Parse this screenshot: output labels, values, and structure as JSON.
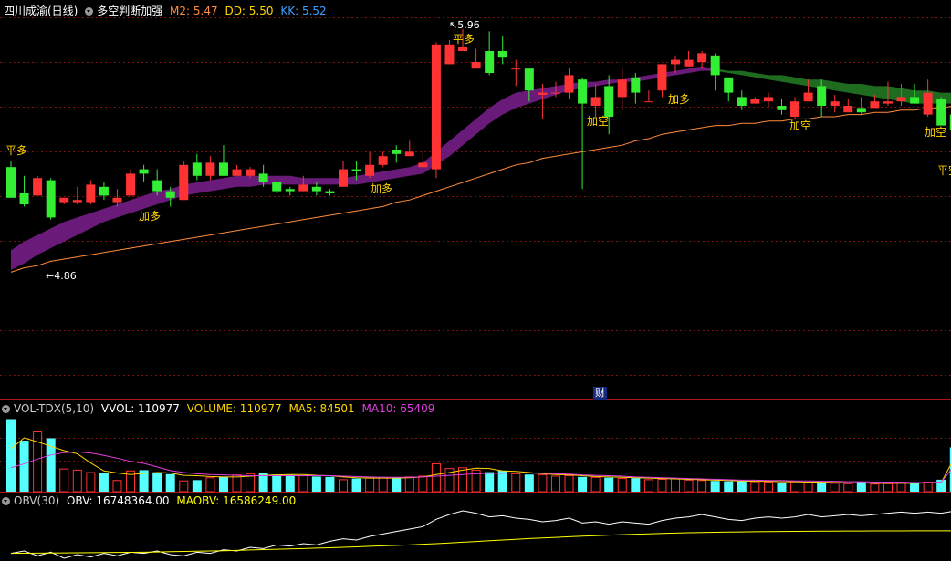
{
  "main_header": {
    "stock": "四川成渝(日线)",
    "indicator": "多空判断加强",
    "m2": "M2: 5.47",
    "dd": "DD: 5.50",
    "kk": "KK: 5.52"
  },
  "vol_header": {
    "name": "VOL-TDX(5,10)",
    "vvol": "VVOL: 110977",
    "volume": "VOLUME: 110977",
    "ma5": "MA5: 84501",
    "ma10": "MA10: 65409"
  },
  "obv_header": {
    "name": "OBV(30)",
    "obv": "OBV: 16748364.00",
    "maobv": "MAOBV: 16586249.00"
  },
  "annotations": {
    "high_price": "5.96",
    "low_price": "4.86",
    "cai": "财"
  },
  "signals": [
    {
      "label": "平多",
      "key": "s0"
    },
    {
      "label": "加多",
      "key": "s1"
    },
    {
      "label": "加多",
      "key": "s2"
    },
    {
      "label": "平多",
      "key": "s3"
    },
    {
      "label": "加空",
      "key": "s4"
    },
    {
      "label": "加多",
      "key": "s5"
    },
    {
      "label": "加空",
      "key": "s6"
    },
    {
      "label": "加空",
      "key": "s7"
    },
    {
      "label": "平空",
      "key": "s8"
    }
  ],
  "colors": {
    "background": "#000000",
    "up_candle": "#ff3333",
    "down_candle": "#33ee33",
    "vol_down": "#55ffff",
    "ribbon_long": "#6a1b7a",
    "ribbon_short": "#1f6b1f",
    "ma_line": "#ff8c3a",
    "grid": "#7a1010",
    "signal_text": "#ffd400",
    "m2": "#ff8c3a",
    "dd": "#ffd400",
    "kk": "#3aa0ff",
    "ma10": "#e040e0",
    "obv_line": "#ffffff",
    "maobv_line": "#ffff00"
  },
  "chart_data": {
    "type": "candlestick",
    "y_range": [
      4.86,
      5.96
    ],
    "candles": [
      [
        5.33,
        5.19,
        5.36,
        5.19
      ],
      [
        5.21,
        5.16,
        5.29,
        5.15
      ],
      [
        5.2,
        5.28,
        5.29,
        5.2
      ],
      [
        5.27,
        5.1,
        5.28,
        5.09
      ],
      [
        5.17,
        5.19,
        5.19,
        5.16
      ],
      [
        5.17,
        5.18,
        5.24,
        5.16
      ],
      [
        5.17,
        5.25,
        5.27,
        5.16
      ],
      [
        5.24,
        5.2,
        5.26,
        5.18
      ],
      [
        5.17,
        5.19,
        5.23,
        5.15
      ],
      [
        5.2,
        5.3,
        5.32,
        5.2
      ],
      [
        5.32,
        5.3,
        5.34,
        5.26
      ],
      [
        5.27,
        5.22,
        5.32,
        5.2
      ],
      [
        5.22,
        5.19,
        5.24,
        5.15
      ],
      [
        5.18,
        5.34,
        5.36,
        5.18
      ],
      [
        5.35,
        5.29,
        5.39,
        5.27
      ],
      [
        5.29,
        5.35,
        5.38,
        5.27
      ],
      [
        5.35,
        5.29,
        5.43,
        5.29
      ],
      [
        5.29,
        5.32,
        5.34,
        5.29
      ],
      [
        5.29,
        5.32,
        5.33,
        5.28
      ],
      [
        5.3,
        5.26,
        5.34,
        5.24
      ],
      [
        5.26,
        5.22,
        5.24,
        5.21
      ],
      [
        5.23,
        5.22,
        5.24,
        5.2
      ],
      [
        5.22,
        5.25,
        5.29,
        5.22
      ],
      [
        5.24,
        5.22,
        5.26,
        5.2
      ],
      [
        5.22,
        5.21,
        5.23,
        5.2
      ],
      [
        5.24,
        5.32,
        5.36,
        5.24
      ],
      [
        5.32,
        5.31,
        5.36,
        5.27
      ],
      [
        5.29,
        5.34,
        5.4,
        5.28
      ],
      [
        5.34,
        5.38,
        5.4,
        5.33
      ],
      [
        5.41,
        5.39,
        5.43,
        5.35
      ],
      [
        5.38,
        5.4,
        5.45,
        5.38
      ],
      [
        5.33,
        5.35,
        5.41,
        5.32
      ],
      [
        5.32,
        5.89,
        5.9,
        5.28
      ],
      [
        5.8,
        5.89,
        5.91,
        5.8
      ],
      [
        5.86,
        5.88,
        5.96,
        5.86
      ],
      [
        5.78,
        5.81,
        5.87,
        5.79
      ],
      [
        5.86,
        5.76,
        5.95,
        5.75
      ],
      [
        5.86,
        5.83,
        5.93,
        5.8
      ],
      [
        5.78,
        5.78,
        5.82,
        5.7
      ],
      [
        5.78,
        5.68,
        5.78,
        5.63
      ],
      [
        5.66,
        5.67,
        5.71,
        5.55
      ],
      [
        5.67,
        5.67,
        5.72,
        5.65
      ],
      [
        5.67,
        5.75,
        5.78,
        5.64
      ],
      [
        5.73,
        5.62,
        5.74,
        5.23
      ],
      [
        5.61,
        5.65,
        5.71,
        5.56
      ],
      [
        5.7,
        5.56,
        5.75,
        5.48
      ],
      [
        5.65,
        5.73,
        5.78,
        5.59
      ],
      [
        5.74,
        5.67,
        5.76,
        5.62
      ],
      [
        5.63,
        5.63,
        5.68,
        5.63
      ],
      [
        5.68,
        5.8,
        5.8,
        5.65
      ],
      [
        5.8,
        5.82,
        5.84,
        5.76
      ],
      [
        5.79,
        5.82,
        5.86,
        5.79
      ],
      [
        5.81,
        5.85,
        5.86,
        5.78
      ],
      [
        5.84,
        5.75,
        5.85,
        5.68
      ],
      [
        5.74,
        5.67,
        5.73,
        5.63
      ],
      [
        5.65,
        5.61,
        5.68,
        5.59
      ],
      [
        5.62,
        5.64,
        5.65,
        5.62
      ],
      [
        5.63,
        5.65,
        5.67,
        5.6
      ],
      [
        5.61,
        5.59,
        5.64,
        5.57
      ],
      [
        5.56,
        5.63,
        5.65,
        5.55
      ],
      [
        5.63,
        5.67,
        5.73,
        5.63
      ],
      [
        5.7,
        5.61,
        5.73,
        5.56
      ],
      [
        5.61,
        5.63,
        5.66,
        5.58
      ],
      [
        5.58,
        5.61,
        5.64,
        5.58
      ],
      [
        5.6,
        5.58,
        5.65,
        5.57
      ],
      [
        5.6,
        5.63,
        5.66,
        5.61
      ],
      [
        5.62,
        5.63,
        5.72,
        5.61
      ],
      [
        5.63,
        5.65,
        5.71,
        5.61
      ],
      [
        5.65,
        5.62,
        5.71,
        5.62
      ],
      [
        5.57,
        5.67,
        5.73,
        5.56
      ],
      [
        5.64,
        5.52,
        5.65,
        5.52
      ],
      [
        5.57,
        5.5,
        5.6,
        5.5
      ]
    ],
    "ma_line": [
      4.85,
      4.87,
      4.88,
      4.9,
      4.91,
      4.92,
      4.93,
      4.94,
      4.95,
      4.96,
      4.97,
      4.98,
      4.99,
      5.0,
      5.01,
      5.02,
      5.03,
      5.04,
      5.05,
      5.06,
      5.07,
      5.08,
      5.09,
      5.1,
      5.11,
      5.12,
      5.13,
      5.14,
      5.15,
      5.17,
      5.18,
      5.2,
      5.22,
      5.24,
      5.26,
      5.28,
      5.3,
      5.32,
      5.34,
      5.35,
      5.37,
      5.38,
      5.39,
      5.4,
      5.41,
      5.42,
      5.43,
      5.45,
      5.46,
      5.48,
      5.49,
      5.5,
      5.51,
      5.52,
      5.52,
      5.53,
      5.53,
      5.54,
      5.54,
      5.55,
      5.55,
      5.56,
      5.56,
      5.57,
      5.57,
      5.58,
      5.58,
      5.59,
      5.59,
      5.6,
      5.6,
      5.61
    ],
    "ribbon_upper": [
      4.95,
      4.99,
      5.02,
      5.05,
      5.08,
      5.1,
      5.12,
      5.14,
      5.16,
      5.18,
      5.2,
      5.22,
      5.23,
      5.25,
      5.26,
      5.27,
      5.28,
      5.29,
      5.29,
      5.29,
      5.29,
      5.29,
      5.28,
      5.28,
      5.28,
      5.28,
      5.29,
      5.3,
      5.31,
      5.32,
      5.33,
      5.35,
      5.4,
      5.45,
      5.5,
      5.55,
      5.6,
      5.64,
      5.67,
      5.68,
      5.69,
      5.7,
      5.71,
      5.72,
      5.72,
      5.73,
      5.73,
      5.74,
      5.75,
      5.76,
      5.77,
      5.78,
      5.79,
      5.78,
      5.77,
      5.77,
      5.76,
      5.75,
      5.75,
      5.74,
      5.73,
      5.73,
      5.72,
      5.71,
      5.71,
      5.7,
      5.7,
      5.69,
      5.68,
      5.68,
      5.67,
      5.67
    ],
    "ribbon_lower": [
      4.86,
      4.89,
      4.93,
      4.96,
      4.99,
      5.02,
      5.05,
      5.08,
      5.1,
      5.12,
      5.14,
      5.16,
      5.18,
      5.2,
      5.21,
      5.22,
      5.23,
      5.24,
      5.24,
      5.25,
      5.25,
      5.25,
      5.25,
      5.25,
      5.25,
      5.25,
      5.25,
      5.26,
      5.27,
      5.28,
      5.29,
      5.3,
      5.34,
      5.38,
      5.43,
      5.48,
      5.53,
      5.57,
      5.6,
      5.62,
      5.64,
      5.66,
      5.68,
      5.69,
      5.7,
      5.71,
      5.72,
      5.72,
      5.73,
      5.74,
      5.75,
      5.76,
      5.77,
      5.77,
      5.76,
      5.75,
      5.74,
      5.73,
      5.72,
      5.71,
      5.7,
      5.69,
      5.68,
      5.67,
      5.66,
      5.65,
      5.64,
      5.63,
      5.62,
      5.62,
      5.62,
      5.62
    ],
    "ribbon_short_start": 53,
    "volume": [
      182000,
      128000,
      150000,
      134000,
      57000,
      54000,
      48000,
      47000,
      28000,
      52000,
      54000,
      47000,
      44000,
      27000,
      29000,
      35000,
      38000,
      42000,
      45000,
      46000,
      43000,
      42000,
      40000,
      38000,
      37000,
      30000,
      33000,
      35000,
      36000,
      35000,
      37000,
      39000,
      70000,
      58000,
      60000,
      54000,
      49000,
      53000,
      45000,
      43000,
      42000,
      39000,
      40000,
      37000,
      36000,
      35000,
      33000,
      34000,
      30000,
      31000,
      32000,
      29000,
      28000,
      27000,
      26000,
      27000,
      25000,
      24000,
      23000,
      25000,
      24000,
      22000,
      21000,
      20000,
      24000,
      19000,
      20000,
      22000,
      21000,
      24000,
      30000,
      110977
    ],
    "vol_ma5": [
      108000,
      135000,
      125000,
      114000,
      103000,
      95000,
      72000,
      52000,
      47000,
      43000,
      46000,
      48000,
      47000,
      41000,
      40000,
      38000,
      37000,
      37000,
      39000,
      41000,
      42000,
      43000,
      43000,
      41000,
      40000,
      37000,
      35000,
      34000,
      34000,
      34000,
      35000,
      37000,
      43000,
      48000,
      54000,
      59000,
      58000,
      52000,
      51000,
      48000,
      45000,
      43000,
      42000,
      40000,
      38000,
      37000,
      36000,
      35000,
      34000,
      33000,
      32000,
      31000,
      30000,
      29000,
      28000,
      27000,
      26000,
      26000,
      25000,
      25000,
      24000,
      24000,
      23000,
      22000,
      22000,
      21000,
      21000,
      21000,
      21000,
      22000,
      23000,
      84501
    ],
    "vol_ma10": [
      60000,
      70000,
      82000,
      92000,
      98000,
      100000,
      97000,
      91000,
      84000,
      76000,
      71000,
      62000,
      53000,
      48000,
      45000,
      43000,
      42000,
      41000,
      40000,
      40000,
      40000,
      40000,
      40000,
      40000,
      40000,
      39000,
      38000,
      37000,
      36000,
      36000,
      36000,
      37000,
      39000,
      41000,
      43000,
      45000,
      46000,
      46000,
      47000,
      47000,
      46000,
      45000,
      44000,
      42000,
      41000,
      40000,
      39000,
      37000,
      36000,
      35000,
      34000,
      33000,
      32000,
      31000,
      30000,
      29000,
      29000,
      28000,
      28000,
      27000,
      27000,
      26000,
      26000,
      25000,
      25000,
      24000,
      24000,
      24000,
      23000,
      23000,
      24000,
      65409
    ],
    "obv": [
      16400000,
      16420000,
      16380000,
      16410000,
      16360000,
      16390000,
      16370000,
      16400000,
      16380000,
      16410000,
      16400000,
      16420000,
      16390000,
      16380000,
      16410000,
      16400000,
      16430000,
      16420000,
      16450000,
      16440000,
      16470000,
      16460000,
      16480000,
      16470000,
      16500000,
      16520000,
      16510000,
      16540000,
      16560000,
      16580000,
      16600000,
      16620000,
      16680000,
      16720000,
      16750000,
      16730000,
      16700000,
      16710000,
      16690000,
      16680000,
      16660000,
      16670000,
      16690000,
      16650000,
      16660000,
      16640000,
      16660000,
      16650000,
      16640000,
      16670000,
      16690000,
      16700000,
      16720000,
      16700000,
      16680000,
      16670000,
      16690000,
      16700000,
      16690000,
      16700000,
      16720000,
      16700000,
      16710000,
      16720000,
      16710000,
      16720000,
      16730000,
      16740000,
      16730000,
      16740000,
      16730000,
      16748364
    ],
    "maobv": [
      16400000,
      16401000,
      16402000,
      16403000,
      16404000,
      16405000,
      16406000,
      16407000,
      16408000,
      16409000,
      16410000,
      16412000,
      16414000,
      16416000,
      16418000,
      16420000,
      16422000,
      16425000,
      16428000,
      16431000,
      16434000,
      16437000,
      16440000,
      16443000,
      16446000,
      16450000,
      16454000,
      16458000,
      16462000,
      16466000,
      16470000,
      16475000,
      16480000,
      16486000,
      16492000,
      16498000,
      16504000,
      16510000,
      16516000,
      16522000,
      16527000,
      16532000,
      16537000,
      16542000,
      16546000,
      16550000,
      16554000,
      16558000,
      16561000,
      16564000,
      16567000,
      16570000,
      16572000,
      16574000,
      16576000,
      16577000,
      16578000,
      16579000,
      16580000,
      16581000,
      16582000,
      16583000,
      16583000,
      16584000,
      16584000,
      16585000,
      16585000,
      16585000,
      16586000,
      16586000,
      16586000,
      16586249
    ]
  }
}
